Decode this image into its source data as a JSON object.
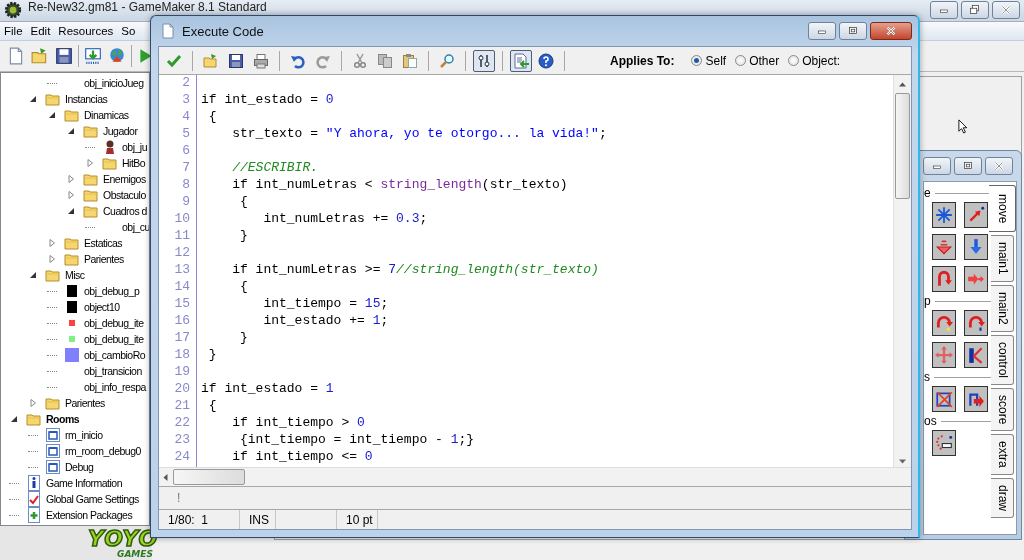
{
  "main_window": {
    "title": "Re-New32.gm81 - GameMaker 8.1 Standard",
    "menu": [
      "File",
      "Edit",
      "Resources",
      "So"
    ],
    "toolbar": [
      [
        {
          "kind": "new"
        },
        {
          "kind": "open"
        },
        {
          "kind": "save"
        }
      ],
      [
        {
          "kind": "create-exe"
        },
        {
          "kind": "publish"
        }
      ],
      [
        {
          "kind": "run"
        }
      ]
    ],
    "logo": {
      "top": "YOYO",
      "bottom": "GAMES"
    }
  },
  "tree": {
    "hidden_tail": [
      {
        "label": "obj_inicioJueg",
        "kind": "blank"
      }
    ],
    "objects": [
      {
        "label": "Instancias",
        "kind": "folder",
        "expanded": true,
        "children": [
          {
            "label": "Dinamicas",
            "kind": "folder",
            "expanded": true,
            "children": [
              {
                "label": "Jugador",
                "kind": "folder",
                "expanded": true,
                "children": [
                  {
                    "label": "obj_ju",
                    "kind": "figure"
                  },
                  {
                    "label": "HitBo",
                    "kind": "folder",
                    "expanded": false
                  }
                ]
              },
              {
                "label": "Enemigos",
                "kind": "folder",
                "expanded": false
              },
              {
                "label": "Obstaculo",
                "kind": "folder",
                "expanded": false
              },
              {
                "label": "Cuadros d",
                "kind": "folder",
                "expanded": true,
                "children": [
                  {
                    "label": "obj_cu",
                    "kind": "blank"
                  }
                ]
              }
            ]
          },
          {
            "label": "Estaticas",
            "kind": "folder",
            "expanded": false
          },
          {
            "label": "Parientes",
            "kind": "folder",
            "expanded": false
          }
        ]
      },
      {
        "label": "Misc",
        "kind": "folder",
        "expanded": true,
        "children": [
          {
            "label": "obj_debug_p",
            "kind": "block",
            "color": "#000000"
          },
          {
            "label": "object10",
            "kind": "block",
            "color": "#000000"
          },
          {
            "label": "obj_debug_ite",
            "kind": "dot",
            "color": "#ff4040"
          },
          {
            "label": "obj_debug_ite",
            "kind": "dot",
            "color": "#80f080"
          },
          {
            "label": "obj_cambioRo",
            "kind": "tile",
            "color": "#8080ff"
          },
          {
            "label": "obj_transicion",
            "kind": "blank"
          },
          {
            "label": "obj_info_respa",
            "kind": "blank"
          }
        ]
      },
      {
        "label": "Parientes",
        "kind": "folder",
        "expanded": false
      }
    ],
    "items": [
      {
        "label": "Rooms",
        "kind": "folder",
        "expanded": true,
        "bold": true,
        "children": [
          {
            "label": "rm_inicio",
            "kind": "room"
          },
          {
            "label": "rm_room_debug0",
            "kind": "room"
          },
          {
            "label": "Debug",
            "kind": "room"
          }
        ]
      },
      {
        "label": "Game Information",
        "kind": "info",
        "bold": false
      },
      {
        "label": "Global Game Settings",
        "kind": "settings",
        "bold": false
      },
      {
        "label": "Extension Packages",
        "kind": "extension",
        "bold": false
      }
    ]
  },
  "code_window": {
    "title": "Execute Code",
    "toolbar": [
      [
        {
          "kind": "apply",
          "pressed": false
        }
      ],
      [
        {
          "kind": "open",
          "pressed": false
        },
        {
          "kind": "save",
          "pressed": false
        },
        {
          "kind": "print",
          "pressed": false
        }
      ],
      [
        {
          "kind": "undo",
          "pressed": false
        },
        {
          "kind": "redo",
          "pressed": false
        }
      ],
      [
        {
          "kind": "cut",
          "pressed": false
        },
        {
          "kind": "copy",
          "pressed": false
        },
        {
          "kind": "paste",
          "pressed": false
        }
      ],
      [
        {
          "kind": "find",
          "pressed": false
        }
      ],
      [
        {
          "kind": "syntax",
          "pressed": true
        }
      ],
      [
        {
          "kind": "insert",
          "pressed": true
        },
        {
          "kind": "help",
          "pressed": false
        }
      ]
    ],
    "applies_to": {
      "label": "Applies To:",
      "options": [
        {
          "label": "Self",
          "selected": true
        },
        {
          "label": "Other",
          "selected": false
        },
        {
          "label": "Object:",
          "selected": false
        }
      ]
    },
    "lines": [
      {
        "no": "2"
      },
      {
        "no": "3",
        "tokens": [
          {
            "text": "if int_estado = ",
            "kind": "plain"
          },
          {
            "text": "0",
            "kind": "number"
          }
        ]
      },
      {
        "no": "4",
        "tokens": [
          {
            "text": " {",
            "kind": "plain"
          }
        ]
      },
      {
        "no": "5",
        "tokens": [
          {
            "text": "    str_texto = ",
            "kind": "plain"
          },
          {
            "text": "\"Y ahora, yo te otorgo... la vida!\"",
            "kind": "string"
          },
          {
            "text": ";",
            "kind": "plain"
          }
        ]
      },
      {
        "no": "6"
      },
      {
        "no": "7",
        "tokens": [
          {
            "text": "    //ESCRIBIR.",
            "kind": "comment"
          }
        ]
      },
      {
        "no": "8",
        "tokens": [
          {
            "text": "    if int_numLetras < ",
            "kind": "plain"
          },
          {
            "text": "string_length",
            "kind": "function"
          },
          {
            "text": "(str_texto)",
            "kind": "plain"
          }
        ]
      },
      {
        "no": "9",
        "tokens": [
          {
            "text": "     {",
            "kind": "plain"
          }
        ]
      },
      {
        "no": "10",
        "tokens": [
          {
            "text": "        int_numLetras += ",
            "kind": "plain"
          },
          {
            "text": "0.3",
            "kind": "number"
          },
          {
            "text": ";",
            "kind": "plain"
          }
        ]
      },
      {
        "no": "11",
        "tokens": [
          {
            "text": "     }",
            "kind": "plain"
          }
        ]
      },
      {
        "no": "12"
      },
      {
        "no": "13",
        "tokens": [
          {
            "text": "    if int_numLetras >= ",
            "kind": "plain"
          },
          {
            "text": "7",
            "kind": "number"
          },
          {
            "text": "//string_length(str_texto)",
            "kind": "comment"
          }
        ]
      },
      {
        "no": "14",
        "tokens": [
          {
            "text": "     {",
            "kind": "plain"
          }
        ]
      },
      {
        "no": "15",
        "tokens": [
          {
            "text": "        int_tiempo = ",
            "kind": "plain"
          },
          {
            "text": "15",
            "kind": "number"
          },
          {
            "text": ";",
            "kind": "plain"
          }
        ]
      },
      {
        "no": "16",
        "tokens": [
          {
            "text": "        int_estado += ",
            "kind": "plain"
          },
          {
            "text": "1",
            "kind": "number"
          },
          {
            "text": ";",
            "kind": "plain"
          }
        ]
      },
      {
        "no": "17",
        "tokens": [
          {
            "text": "     }",
            "kind": "plain"
          }
        ]
      },
      {
        "no": "18",
        "tokens": [
          {
            "text": " }",
            "kind": "plain"
          }
        ]
      },
      {
        "no": "19"
      },
      {
        "no": "20",
        "tokens": [
          {
            "text": "if int_estado = ",
            "kind": "plain"
          },
          {
            "text": "1",
            "kind": "number"
          }
        ]
      },
      {
        "no": "21",
        "tokens": [
          {
            "text": " {",
            "kind": "plain"
          }
        ]
      },
      {
        "no": "22",
        "tokens": [
          {
            "text": "    if int_tiempo > ",
            "kind": "plain"
          },
          {
            "text": "0",
            "kind": "number"
          }
        ]
      },
      {
        "no": "23",
        "tokens": [
          {
            "text": "     {int_tiempo = int_tiempo - ",
            "kind": "plain"
          },
          {
            "text": "1",
            "kind": "number"
          },
          {
            "text": ";}",
            "kind": "plain"
          }
        ]
      },
      {
        "no": "24",
        "tokens": [
          {
            "text": "    if int_tiempo <= ",
            "kind": "plain"
          },
          {
            "text": "0",
            "kind": "number"
          }
        ]
      }
    ],
    "message": "!",
    "status": [
      "1/80:  1",
      "INS",
      "10 pt"
    ]
  },
  "palette": {
    "sections": [
      {
        "label": "e",
        "actions": [
          {
            "kind": "directions"
          },
          {
            "kind": "move-point"
          },
          {
            "kind": "gravity"
          },
          {
            "kind": "vspeed"
          },
          {
            "kind": "reverse"
          },
          {
            "kind": "speed"
          }
        ]
      },
      {
        "label": "p",
        "actions": [
          {
            "kind": "wrap-light"
          },
          {
            "kind": "wrap-query"
          },
          {
            "kind": "scatter"
          },
          {
            "kind": "bounce"
          }
        ]
      },
      {
        "label": "s",
        "actions": [
          {
            "kind": "path-stop"
          },
          {
            "kind": "path-run"
          }
        ]
      },
      {
        "label": "os",
        "actions": [
          {
            "kind": "dots"
          }
        ]
      }
    ],
    "tabs": [
      {
        "label": "move",
        "selected": true
      },
      {
        "label": "main1",
        "selected": false
      },
      {
        "label": "main2",
        "selected": false
      },
      {
        "label": "control",
        "selected": false
      },
      {
        "label": "score",
        "selected": false
      },
      {
        "label": "extra",
        "selected": false
      },
      {
        "label": "draw",
        "selected": false
      }
    ]
  }
}
